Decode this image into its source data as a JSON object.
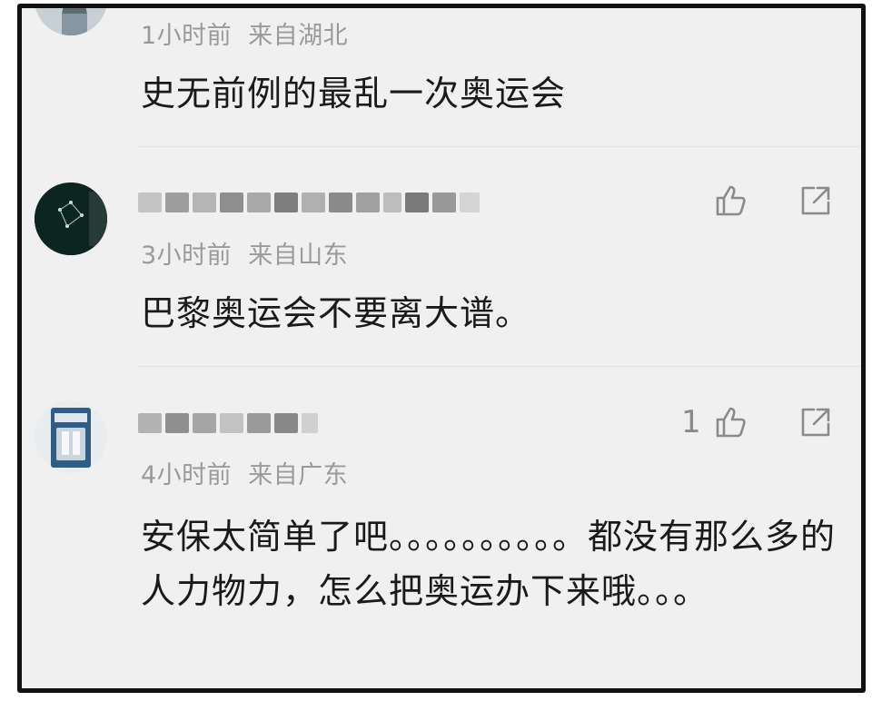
{
  "comments": [
    {
      "time": "1小时前",
      "location": "来自湖北",
      "text": "史无前例的最乱一次奥运会"
    },
    {
      "time": "3小时前",
      "location": "来自山东",
      "text": "巴黎奥运会不要离大谱。"
    },
    {
      "time": "4小时前",
      "location": "来自广东",
      "likes": "1",
      "text": "安保太简单了吧。。。。。。。。。。都没有那么多的人力物力，怎么把奥运办下来哦。。。"
    }
  ],
  "icons": {
    "like": "thumbs-up-icon",
    "share": "share-icon"
  },
  "colors": {
    "background": "#f0f0f0",
    "frame": "#111111",
    "meta_text": "#9a9a9a",
    "body_text": "#1a1a1a",
    "icon": "#8a8a8a"
  }
}
